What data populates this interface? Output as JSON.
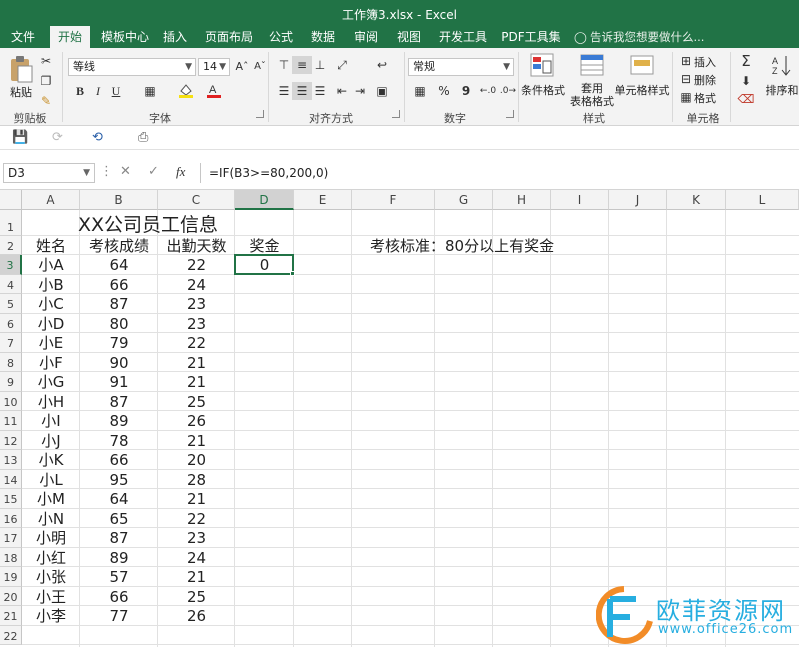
{
  "window": {
    "title": "工作簿3.xlsx - Excel"
  },
  "tabs": [
    {
      "label": "文件",
      "active": false
    },
    {
      "label": "开始",
      "active": true
    },
    {
      "label": "模板中心",
      "active": false
    },
    {
      "label": "插入",
      "active": false
    },
    {
      "label": "页面布局",
      "active": false
    },
    {
      "label": "公式",
      "active": false
    },
    {
      "label": "数据",
      "active": false
    },
    {
      "label": "审阅",
      "active": false
    },
    {
      "label": "视图",
      "active": false
    },
    {
      "label": "开发工具",
      "active": false
    },
    {
      "label": "PDF工具集",
      "active": false
    }
  ],
  "tell_me": "告诉我您想要做什么...",
  "ribbon": {
    "paste_label": "粘贴",
    "font_name": "等线",
    "font_size": "14",
    "bold": "B",
    "italic": "I",
    "underline": "U",
    "number_format": "常规",
    "percent": "%",
    "comma": "9",
    "cond_format": "条件格式",
    "table_format": "套用\n表格格式",
    "table_format_line1": "套用",
    "table_format_line2": "表格格式",
    "cell_styles": "单元格样式",
    "insert": "插入",
    "delete": "删除",
    "format": "格式",
    "sort_filter": "排序和",
    "groups": {
      "clipboard": "剪贴板",
      "font": "字体",
      "alignment": "对齐方式",
      "number": "数字",
      "styles": "样式",
      "cells": "单元格"
    }
  },
  "formula_bar": {
    "name_box": "D3",
    "fx": "fx",
    "formula": "=IF(B3>=80,200,0)"
  },
  "sheet": {
    "columns": [
      "A",
      "B",
      "C",
      "D",
      "E",
      "F",
      "G",
      "H",
      "I",
      "J",
      "K",
      "L"
    ],
    "selected_column": "D",
    "selected_row": 3,
    "row_numbers": [
      1,
      2,
      3,
      4,
      5,
      6,
      7,
      8,
      9,
      10,
      11,
      12,
      13,
      14,
      15,
      16,
      17,
      18,
      19,
      20,
      21,
      22
    ],
    "title": "XX公司员工信息",
    "headers": [
      "姓名",
      "考核成绩",
      "出勤天数",
      "奖金"
    ],
    "note": "考核标准：80分以上有奖金",
    "rows": [
      [
        "小A",
        "64",
        "22",
        "0"
      ],
      [
        "小B",
        "66",
        "24",
        ""
      ],
      [
        "小C",
        "87",
        "23",
        ""
      ],
      [
        "小D",
        "80",
        "23",
        ""
      ],
      [
        "小E",
        "79",
        "22",
        ""
      ],
      [
        "小F",
        "90",
        "21",
        ""
      ],
      [
        "小G",
        "91",
        "21",
        ""
      ],
      [
        "小H",
        "87",
        "25",
        ""
      ],
      [
        "小I",
        "89",
        "26",
        ""
      ],
      [
        "小J",
        "78",
        "21",
        ""
      ],
      [
        "小K",
        "66",
        "20",
        ""
      ],
      [
        "小L",
        "95",
        "28",
        ""
      ],
      [
        "小M",
        "64",
        "21",
        ""
      ],
      [
        "小N",
        "65",
        "22",
        ""
      ],
      [
        "小明",
        "87",
        "23",
        ""
      ],
      [
        "小红",
        "89",
        "24",
        ""
      ],
      [
        "小张",
        "57",
        "21",
        ""
      ],
      [
        "小王",
        "66",
        "25",
        ""
      ],
      [
        "小李",
        "77",
        "26",
        ""
      ]
    ]
  },
  "watermark": {
    "brand": "欧菲资源网",
    "url": "www.office26.com"
  },
  "colors": {
    "accent": "#217346",
    "watermark": "#27aee0"
  }
}
